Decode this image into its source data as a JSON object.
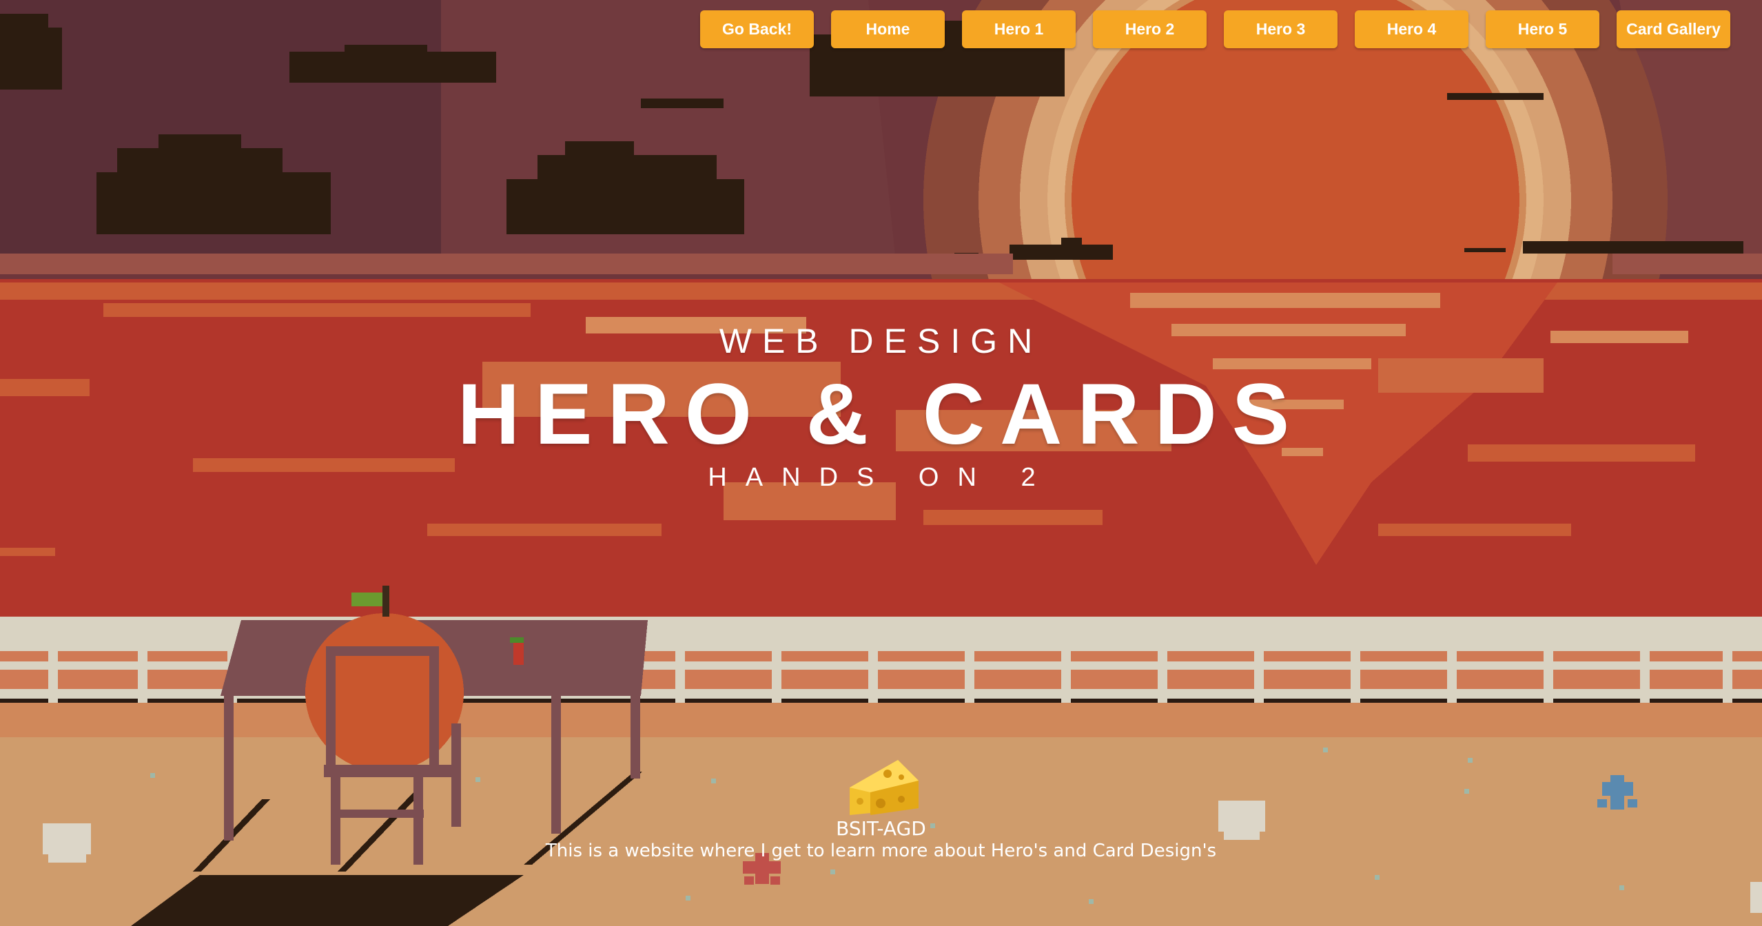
{
  "nav": {
    "items": [
      {
        "label": "Go Back!",
        "name": "go-back-button"
      },
      {
        "label": "Home",
        "name": "home-button"
      },
      {
        "label": "Hero 1",
        "name": "hero-1-button"
      },
      {
        "label": "Hero 2",
        "name": "hero-2-button"
      },
      {
        "label": "Hero 3",
        "name": "hero-3-button"
      },
      {
        "label": "Hero 4",
        "name": "hero-4-button"
      },
      {
        "label": "Hero 5",
        "name": "hero-5-button"
      },
      {
        "label": "Card Gallery",
        "name": "card-gallery-button"
      }
    ],
    "button_color": "#f6a623"
  },
  "hero": {
    "eyebrow": "WEB DESIGN",
    "title": "HERO & CARDS",
    "subtitle": "HANDS ON 2"
  },
  "footer": {
    "icon": "cheese-icon",
    "org": "BSIT-AGD",
    "description": "This is a website where I get to learn more about Hero's and Card Design's"
  },
  "colors": {
    "sky_dark": "#5e3038",
    "sky": "#7a3a3c",
    "sun": "#c8542e",
    "sun_glow": "#d6a072",
    "sea": "#b2362b",
    "sea_light": "#c95b35",
    "foam": "#d9d3c2",
    "sand": "#cf9c6c",
    "cloud": "#2c1c10",
    "table": "#7c4e51",
    "pumpkin": "#c9572e"
  }
}
